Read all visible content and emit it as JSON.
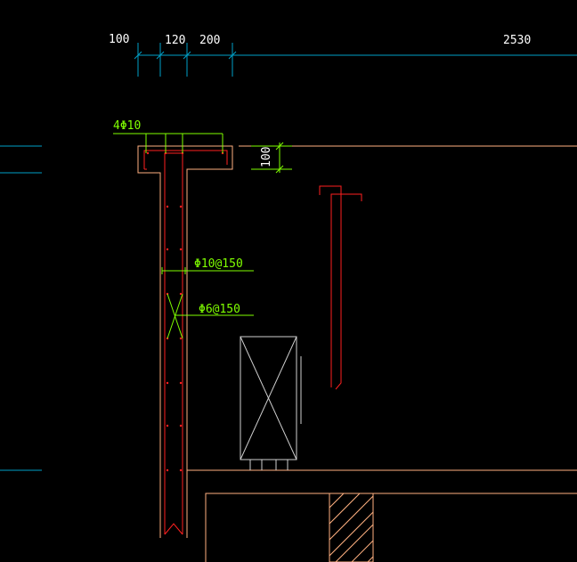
{
  "drawing": {
    "dimensions": {
      "d1": "100",
      "d2": "120",
      "d3": "200",
      "d4": "2530",
      "slab_thickness": "100"
    },
    "annotations": {
      "top_bars": "4Φ10",
      "stirrup_main": "Φ10@150",
      "stirrup_tie": "Φ6@150"
    },
    "colors": {
      "background": "#000000",
      "dimension": "#00a0c8",
      "dimension_text": "#ffffff",
      "annotation": "#80ff00",
      "concrete_outline": "#ffb080",
      "rebar": "#ff2020",
      "equipment": "#d0d0d0"
    }
  }
}
